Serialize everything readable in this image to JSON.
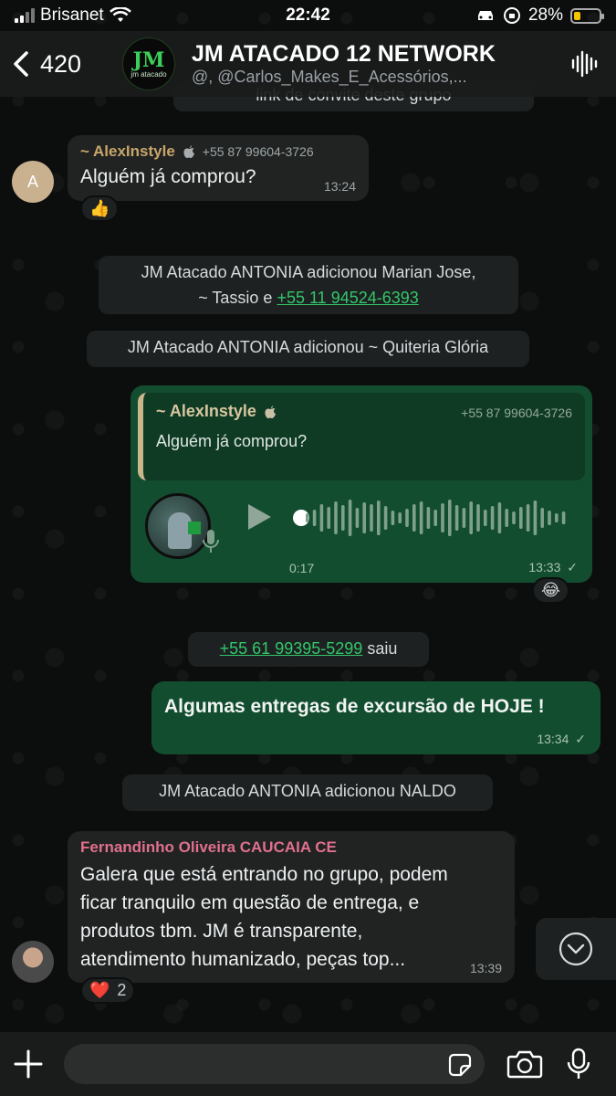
{
  "status_bar": {
    "carrier": "Brisanet",
    "time": "22:42",
    "battery": "28%",
    "battery_level": 0.28
  },
  "header": {
    "back_count": "420",
    "group_logo": "JM",
    "group_logo_sub": "jm atacado",
    "title": "JM ATACADO 12 NETWORK",
    "subtitle": "@, @Carlos_Makes_E_Acessórios,..."
  },
  "messages": {
    "top_partial": "link de convite deste grupo",
    "alex": {
      "avatar_letter": "A",
      "sender": "~ AlexInstyle",
      "phone": "+55 87 99604-3726",
      "text": "Alguém já comprou?",
      "time": "13:24",
      "reaction": "👍"
    },
    "sys_added_1_prefix": "JM Atacado ANTONIA adicionou Marian Jose,",
    "sys_added_1_line2": "~ Tassio e",
    "sys_added_1_link": "+55 11 94524-6393",
    "sys_added_2": "JM Atacado ANTONIA adicionou ~ Quiteria Glória",
    "voice": {
      "quote_name": "~ AlexInstyle",
      "quote_phone": "+55 87 99604-3726",
      "quote_text": "Alguém já comprou?",
      "duration": "0:17",
      "time": "13:33",
      "reaction": "😂"
    },
    "sys_left_link": "+55 61 99395-5299",
    "sys_left_suffix": "saiu",
    "out_text": {
      "text": "Algumas entregas de excursão de HOJE !",
      "time": "13:34"
    },
    "sys_added_3": "JM Atacado ANTONIA adicionou NALDO",
    "fernandinho": {
      "sender": "Fernandinho Oliveira CAUCAIA CE",
      "line1": "Galera que está entrando no grupo, podem",
      "line2": "ficar tranquilo em questão de entrega, e",
      "line3": "produtos tbm. JM é transparente,",
      "line4": "atendimento humanizado, peças top...",
      "time": "13:39",
      "reaction": "❤️",
      "reaction_count": "2"
    }
  },
  "input_bar": {
    "placeholder": ""
  },
  "colors": {
    "accent_green": "#32c76a",
    "out_bubble": "#134d2f",
    "in_bubble": "#202322",
    "sender_alex": "#c9a56b",
    "sender_fernandinho": "#e0708e"
  }
}
